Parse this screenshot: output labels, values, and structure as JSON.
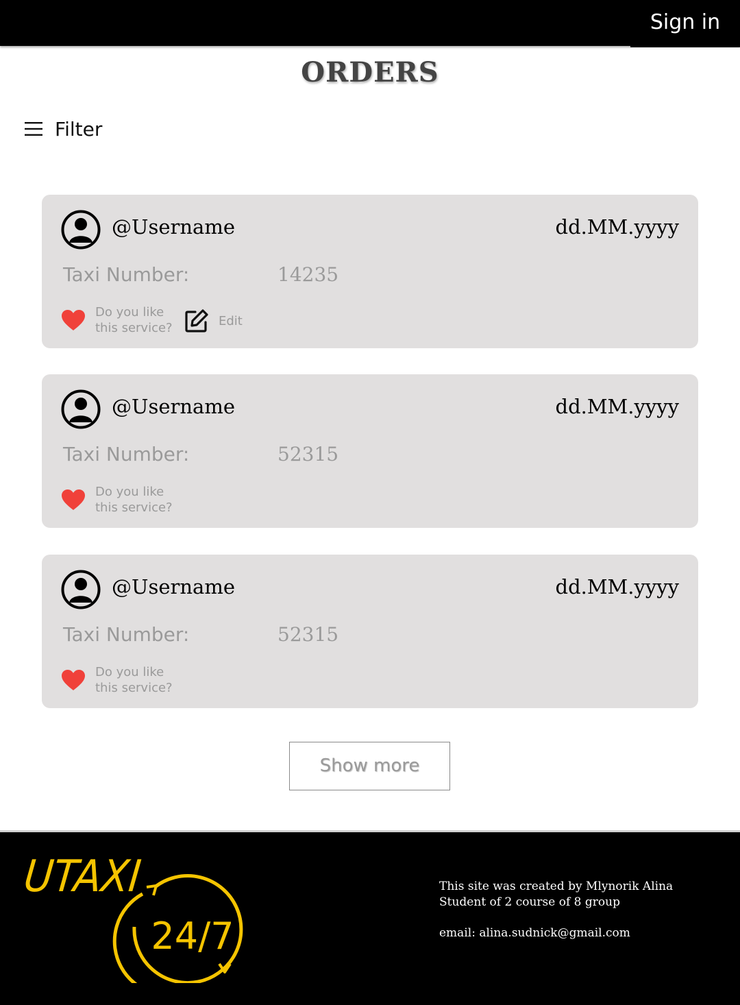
{
  "header": {
    "signin_label": "Sign in"
  },
  "page": {
    "title": "ORDERS"
  },
  "filter": {
    "label": "Filter",
    "icon": "hamburger-menu-icon"
  },
  "orders": [
    {
      "username": "@Username",
      "date": "dd.MM.yyyy",
      "taxi_label": "Taxi Number:",
      "taxi_number": "14235",
      "like_text_1": "Do you like",
      "like_text_2": "this service?",
      "edit_label": "Edit"
    },
    {
      "username": "@Username",
      "date": "dd.MM.yyyy",
      "taxi_label": "Taxi Number:",
      "taxi_number": "52315",
      "like_text_1": "Do you like",
      "like_text_2": "this service?"
    },
    {
      "username": "@Username",
      "date": "dd.MM.yyyy",
      "taxi_label": "Taxi Number:",
      "taxi_number": "52315",
      "like_text_1": "Do you like",
      "like_text_2": "this service?"
    }
  ],
  "show_more_label": "Show more",
  "footer": {
    "logo_text": "UTAXI",
    "logo_badge": "24/7",
    "credit_line_1": "This site was created by Mlynorik Alina",
    "credit_line_2": "Student of 2 course of 8 group",
    "email": "email: alina.sudnick@gmail.com"
  },
  "colors": {
    "header_bg": "#000000",
    "card_bg": "#e1dfdf",
    "heart": "#f0413a",
    "logo": "#f5c400",
    "muted_text": "#9a9a9a"
  }
}
